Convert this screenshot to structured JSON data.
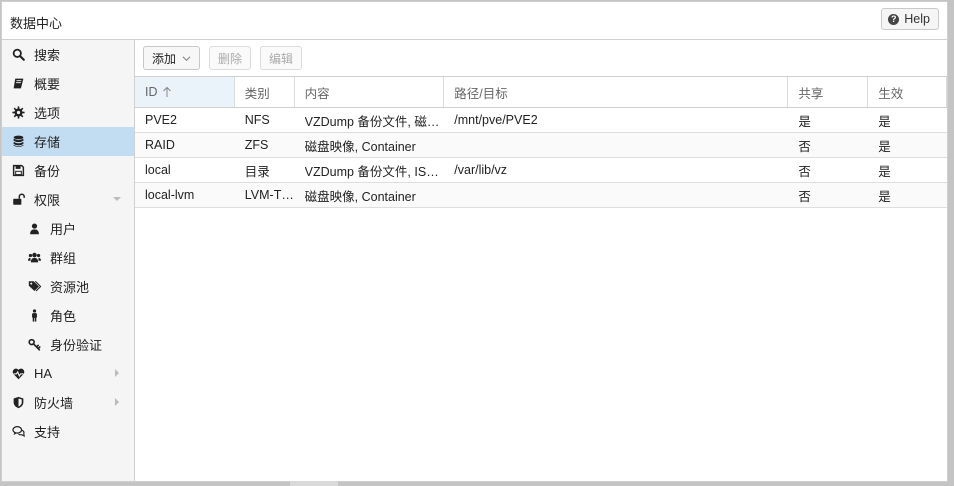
{
  "window": {
    "title": "数据中心",
    "help_label": "Help"
  },
  "sidebar": {
    "items": [
      {
        "label": "搜索",
        "icon": "search-icon"
      },
      {
        "label": "概要",
        "icon": "book-icon"
      },
      {
        "label": "选项",
        "icon": "gear-icon"
      },
      {
        "label": "存储",
        "icon": "database-icon",
        "selected": true
      },
      {
        "label": "备份",
        "icon": "floppy-icon"
      },
      {
        "label": "权限",
        "icon": "unlock-icon",
        "expanded": true
      },
      {
        "label": "用户",
        "icon": "user-icon",
        "child": true
      },
      {
        "label": "群组",
        "icon": "users-icon",
        "child": true
      },
      {
        "label": "资源池",
        "icon": "tags-icon",
        "child": true
      },
      {
        "label": "角色",
        "icon": "male-icon",
        "child": true
      },
      {
        "label": "身份验证",
        "icon": "key-icon",
        "child": true
      },
      {
        "label": "HA",
        "icon": "heartbeat-icon"
      },
      {
        "label": "防火墙",
        "icon": "shield-icon"
      },
      {
        "label": "支持",
        "icon": "comments-icon"
      }
    ]
  },
  "toolbar": {
    "add_label": "添加",
    "remove_label": "删除",
    "edit_label": "编辑"
  },
  "grid": {
    "columns": [
      "ID",
      "类别",
      "内容",
      "路径/目标",
      "共享",
      "生效"
    ],
    "rows": [
      {
        "id": "PVE2",
        "type": "NFS",
        "content": "VZDump 备份文件, 磁盘映像",
        "path": "/mnt/pve/PVE2",
        "shared": "是",
        "active": "是"
      },
      {
        "id": "RAID",
        "type": "ZFS",
        "content": "磁盘映像, Container",
        "path": "",
        "shared": "否",
        "active": "是"
      },
      {
        "id": "local",
        "type": "目录",
        "content": "VZDump 备份文件, ISO镜像",
        "path": "/var/lib/vz",
        "shared": "否",
        "active": "是"
      },
      {
        "id": "local-lvm",
        "type": "LVM-Thin",
        "content": "磁盘映像, Container",
        "path": "",
        "shared": "否",
        "active": "是"
      }
    ]
  },
  "colors": {
    "selected_bg": "#c2dcf2",
    "sidebar_bg": "#f5f5f5",
    "border": "#d0d0d0"
  }
}
